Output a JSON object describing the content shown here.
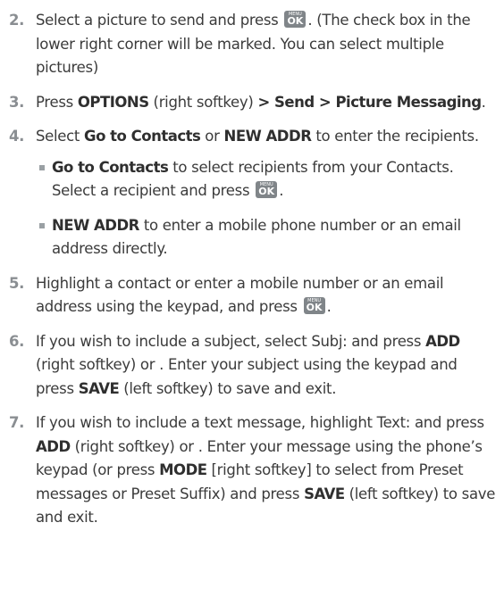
{
  "key": {
    "top": "MENU",
    "main": "OK"
  },
  "steps": {
    "s2": {
      "num": "2.",
      "a": "Select a picture to send and press ",
      "b": ". (The check box in the lower right corner will be marked. You can select multiple pictures)"
    },
    "s3": {
      "num": "3.",
      "a": "Press ",
      "b1": "OPTIONS",
      "c": " (right softkey) ",
      "b2": "> Send > Picture Messaging",
      "d": "."
    },
    "s4": {
      "num": "4.",
      "a": "Select ",
      "b1": "Go to Contacts",
      "c": " or ",
      "b2": "NEW ADDR",
      "d": " to enter the recipients."
    },
    "s4a": {
      "b": "Go to Contacts",
      "t": " to select recipients from your Contacts. Select a recipient and press ",
      "end": "."
    },
    "s4b": {
      "b": "NEW ADDR",
      "t": " to enter a mobile phone number or an email address directly."
    },
    "s5": {
      "num": "5.",
      "a": "Highlight a contact or enter a mobile number or an email address using the keypad, and press ",
      "end": "."
    },
    "s6": {
      "num": "6.",
      "a": "If you wish to include a subject, select Subj: and press ",
      "b1": "ADD",
      "c": " (right softkey) or . Enter your subject using the keypad and press ",
      "b2": "SAVE",
      "d": " (left softkey) to save and exit."
    },
    "s7": {
      "num": "7.",
      "a": "If you wish to include a text message, highlight Text: and press ",
      "b1": "ADD",
      "c": " (right softkey) or . Enter your message using the phone’s keypad (or press ",
      "b2": "MODE",
      "d": " [right softkey] to select from Preset messages or Preset Suffix) and press ",
      "b3": "SAVE",
      "e": " (left softkey) to save and exit."
    }
  }
}
